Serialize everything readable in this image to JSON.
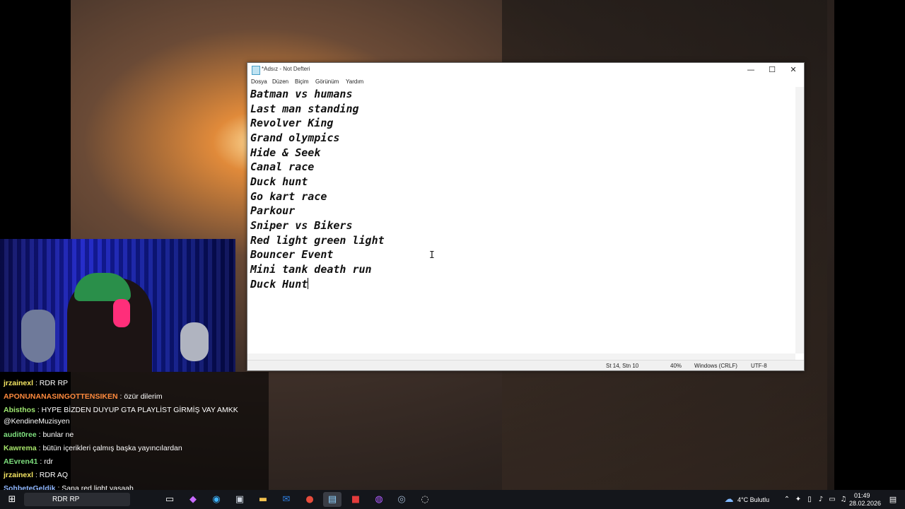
{
  "window": {
    "title": "*Adsız - Not Defteri",
    "minimize": "—",
    "maximize": "☐",
    "close": "✕"
  },
  "menu": [
    "Dosya",
    "Düzen",
    "Biçim",
    "Görünüm",
    "Yardım"
  ],
  "editor": {
    "lines": [
      "Batman vs humans",
      "Last man standing",
      "Revolver King",
      "Grand olympics",
      "Hide & Seek",
      "Canal race",
      "Duck hunt",
      "Go kart race",
      "Parkour",
      "Sniper vs Bikers",
      "Red light green light",
      "Bouncer Event",
      "Mini tank death run",
      "Duck Hunt"
    ]
  },
  "status": {
    "position": "St 14, Stn 10",
    "zoom": "40%",
    "line_ending": "Windows (CRLF)",
    "encoding": "UTF-8"
  },
  "chat": [
    {
      "user": "jrzainexl",
      "text": ": RDR RP",
      "color": "#f5e663"
    },
    {
      "user": "APONUNANASINGOTTENSIKEN",
      "text": ": özür dilerim",
      "color": "#ff8a3d"
    },
    {
      "user": "Abisthos",
      "text": ": HYPE BİZDEN DUYUP GTA PLAYLİST GİRMİŞ VAY AMKK",
      "color": "#9fe870"
    },
    {
      "user": "",
      "text": "@KendineMuzisyen",
      "color": "#ffffff"
    },
    {
      "user": "audit0ree",
      "text": ": bunlar ne",
      "color": "#7ee07e"
    },
    {
      "user": "Kawrema",
      "text": ": bütün içerikleri çalmış başka yayıncılardan",
      "color": "#a6e36a"
    },
    {
      "user": "AEvren41",
      "text": ": rdr",
      "color": "#7ee07e"
    },
    {
      "user": "jrzainexl",
      "text": ": RDR AQ",
      "color": "#f5e663"
    },
    {
      "user": "SohbeteGeldik",
      "text": ": Sana red light yasaah",
      "color": "#8fb7ff"
    }
  ],
  "taskbar": {
    "search_text": "RDR RP",
    "weather": "4°C  Bulutlu",
    "time": "01:49",
    "date": "28.02.2026",
    "icons": [
      "windows-start-icon",
      "task-view-icon",
      "copilot-icon",
      "edge-icon",
      "store-icon",
      "file-explorer-icon",
      "outlook-icon",
      "chrome-icon",
      "notepad-icon",
      "video-editor-icon",
      "messenger-icon",
      "steam-icon",
      "obs-icon"
    ]
  }
}
